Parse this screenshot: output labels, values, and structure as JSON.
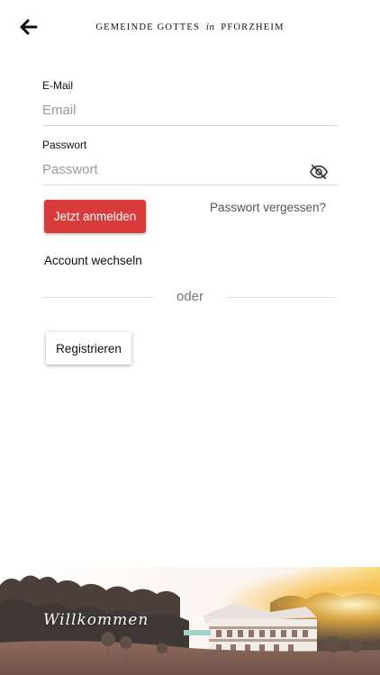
{
  "header": {
    "brand_part1": "Gemeinde Gottes",
    "brand_in": "in",
    "brand_part2": "Pforzheim",
    "back_icon": "arrow-left-icon"
  },
  "email": {
    "label": "E-Mail",
    "placeholder": "Email",
    "value": ""
  },
  "password": {
    "label": "Passwort",
    "placeholder": "Passwort",
    "value": "",
    "toggle_icon": "eye-off-icon"
  },
  "actions": {
    "login_label": "Jetzt anmelden",
    "forgot_label": "Passwort vergessen?",
    "switch_account_label": "Account wechseln",
    "divider_label": "oder",
    "register_label": "Registrieren"
  },
  "banner": {
    "welcome_text": "Willkommen"
  },
  "colors": {
    "primary": "#d93b3b",
    "text": "#111111",
    "muted": "#9a9a9a"
  }
}
